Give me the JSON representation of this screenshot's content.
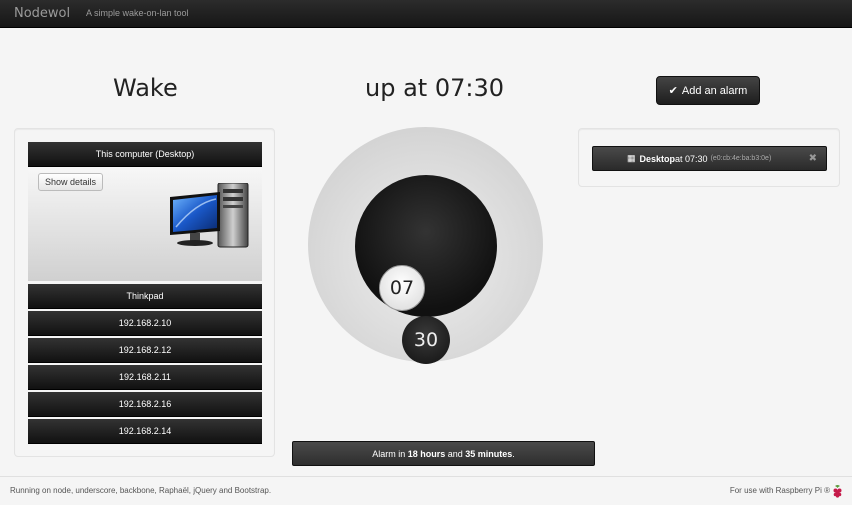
{
  "navbar": {
    "brand": "Nodewol",
    "tagline": "A simple wake-on-lan tool"
  },
  "header": {
    "wake": "Wake",
    "up_at": "up at 07:30",
    "add_alarm": "Add an alarm"
  },
  "devices": [
    {
      "label": "This computer (Desktop)",
      "expanded": true,
      "show_details": "Show details"
    },
    {
      "label": "Thinkpad"
    },
    {
      "label": "192.168.2.10"
    },
    {
      "label": "192.168.2.12"
    },
    {
      "label": "192.168.2.11"
    },
    {
      "label": "192.168.2.16"
    },
    {
      "label": "192.168.2.14"
    }
  ],
  "dial": {
    "hour": "07",
    "minute": "30"
  },
  "alarm_message": {
    "prefix": "Alarm in ",
    "hours": "18 hours",
    "and": " and ",
    "minutes": "35 minutes",
    "suffix": "."
  },
  "alarms": [
    {
      "device": "Desktop",
      "at": " at 07:30",
      "mac": "(e0:cb:4e:ba:b3:0e)"
    }
  ],
  "footer": {
    "left": "Running on node, underscore, backbone, Raphaël, jQuery and Bootstrap.",
    "right": "For use with Raspberry Pi ®"
  },
  "colors": {
    "navbar": "#1b1b1b",
    "dark_button": "#222222",
    "background": "#f5f5f5"
  }
}
